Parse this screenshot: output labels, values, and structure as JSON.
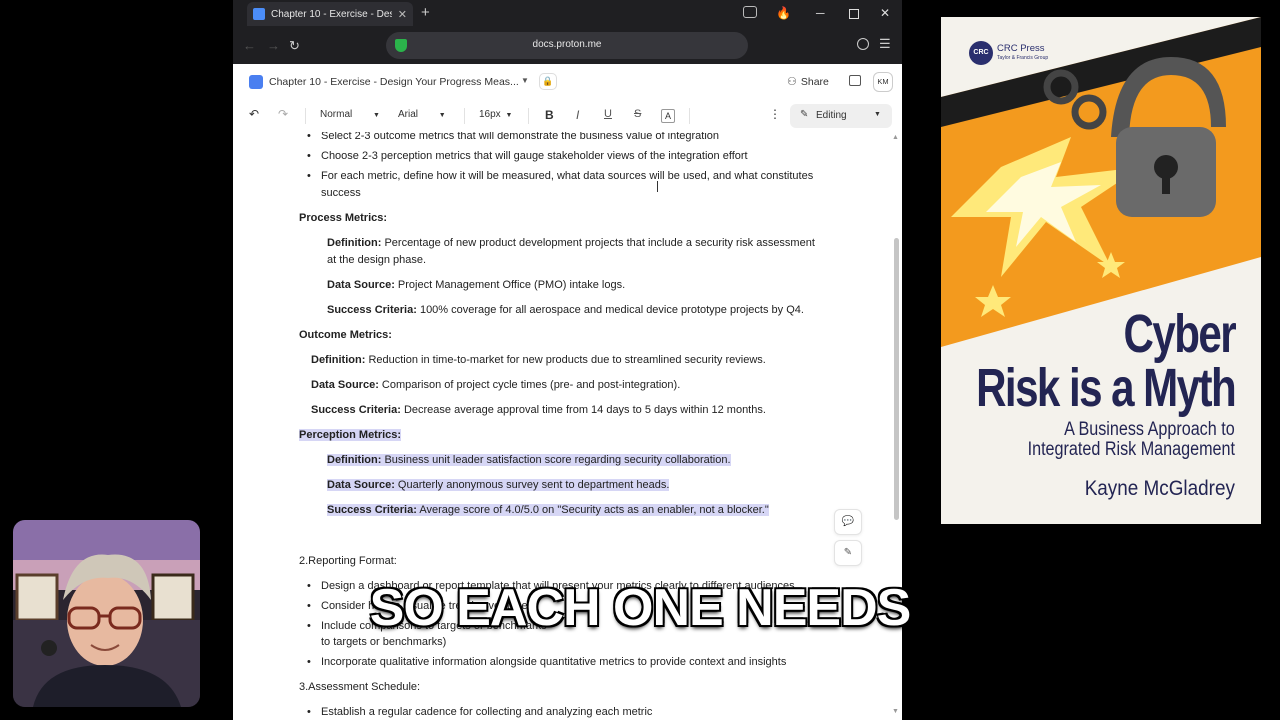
{
  "browser": {
    "tab_title": "Chapter 10 - Exercise - Design",
    "tab_close": "✕",
    "new_tab": "+",
    "url": "docs.proton.me",
    "win_min": "─",
    "win_close": "✕"
  },
  "doc_header": {
    "title": "Chapter 10 - Exercise - Design Your Progress Meas...",
    "share_label": "Share",
    "avatar_initials": "KM"
  },
  "toolbar": {
    "style": "Normal",
    "font": "Arial",
    "size": "16px",
    "bold": "B",
    "italic": "I",
    "underline": "U",
    "strike": "S",
    "font_color": "A",
    "mode": "Editing"
  },
  "document": {
    "top_bullets": [
      "Select 2-3 outcome metrics that will demonstrate the business value of integration",
      "Choose 2-3 perception metrics that will gauge stakeholder views of the integration effort",
      "For each metric, define how it will be measured, what data sources will be used, and what constitutes",
      "success"
    ],
    "process": {
      "heading": "Process Metrics:",
      "def_label": "Definition:",
      "def_text": " Percentage of new product development projects that include a security risk assessment",
      "def_text2": "at the design phase.",
      "src_label": "Data Source:",
      "src_text": " Project Management Office (PMO) intake logs.",
      "crit_label": "Success Criteria:",
      "crit_text": " 100% coverage for all aerospace and medical device prototype projects by Q4."
    },
    "outcome": {
      "heading": "Outcome Metrics:",
      "def_label": "Definition:",
      "def_text": " Reduction in time-to-market for new products due to streamlined security reviews.",
      "src_label": "Data Source:",
      "src_text": " Comparison of project cycle times (pre- and post-integration).",
      "crit_label": "Success Criteria:",
      "crit_text": " Decrease average approval time from 14 days to 5 days within 12 months."
    },
    "perception": {
      "heading": "Perception Metrics:",
      "def_label": "Definition:",
      "def_text": " Business unit leader satisfaction score regarding security collaboration.",
      "src_label": "Data Source:",
      "src_text": " Quarterly anonymous survey sent to department heads.",
      "crit_label": "Success Criteria:",
      "crit_text": " Average score of 4.0/5.0 on \"Security acts as an enabler, not a blocker.\""
    },
    "reporting_heading": "2.Reporting Format:",
    "reporting_bullets": [
      "Design a dashboard or report template that will present your metrics clearly to different audiences",
      "Consider how to visualize trends over time",
      "Include comparisons to targets or benchmarks",
      "to targets or benchmarks)",
      "Incorporate qualitative information alongside quantitative metrics to provide context and insights"
    ],
    "assessment_heading": "3.Assessment Schedule:",
    "assessment_bullets": [
      "Establish a regular cadence for collecting and analyzing each metric"
    ]
  },
  "caption": "SO EACH ONE NEEDS",
  "book": {
    "publisher": "CRC Press",
    "publisher_sub": "Taylor & Francis Group",
    "logo": "CRC",
    "title_line1": "Cyber",
    "title_line2": "Risk is a Myth",
    "subtitle_line1": "A Business Approach to",
    "subtitle_line2": "Integrated Risk Management",
    "author": "Kayne McGladrey"
  },
  "colors": {
    "highlight": "#d6d6f5",
    "book_navy": "#232553",
    "book_orange": "#f39a1e"
  }
}
